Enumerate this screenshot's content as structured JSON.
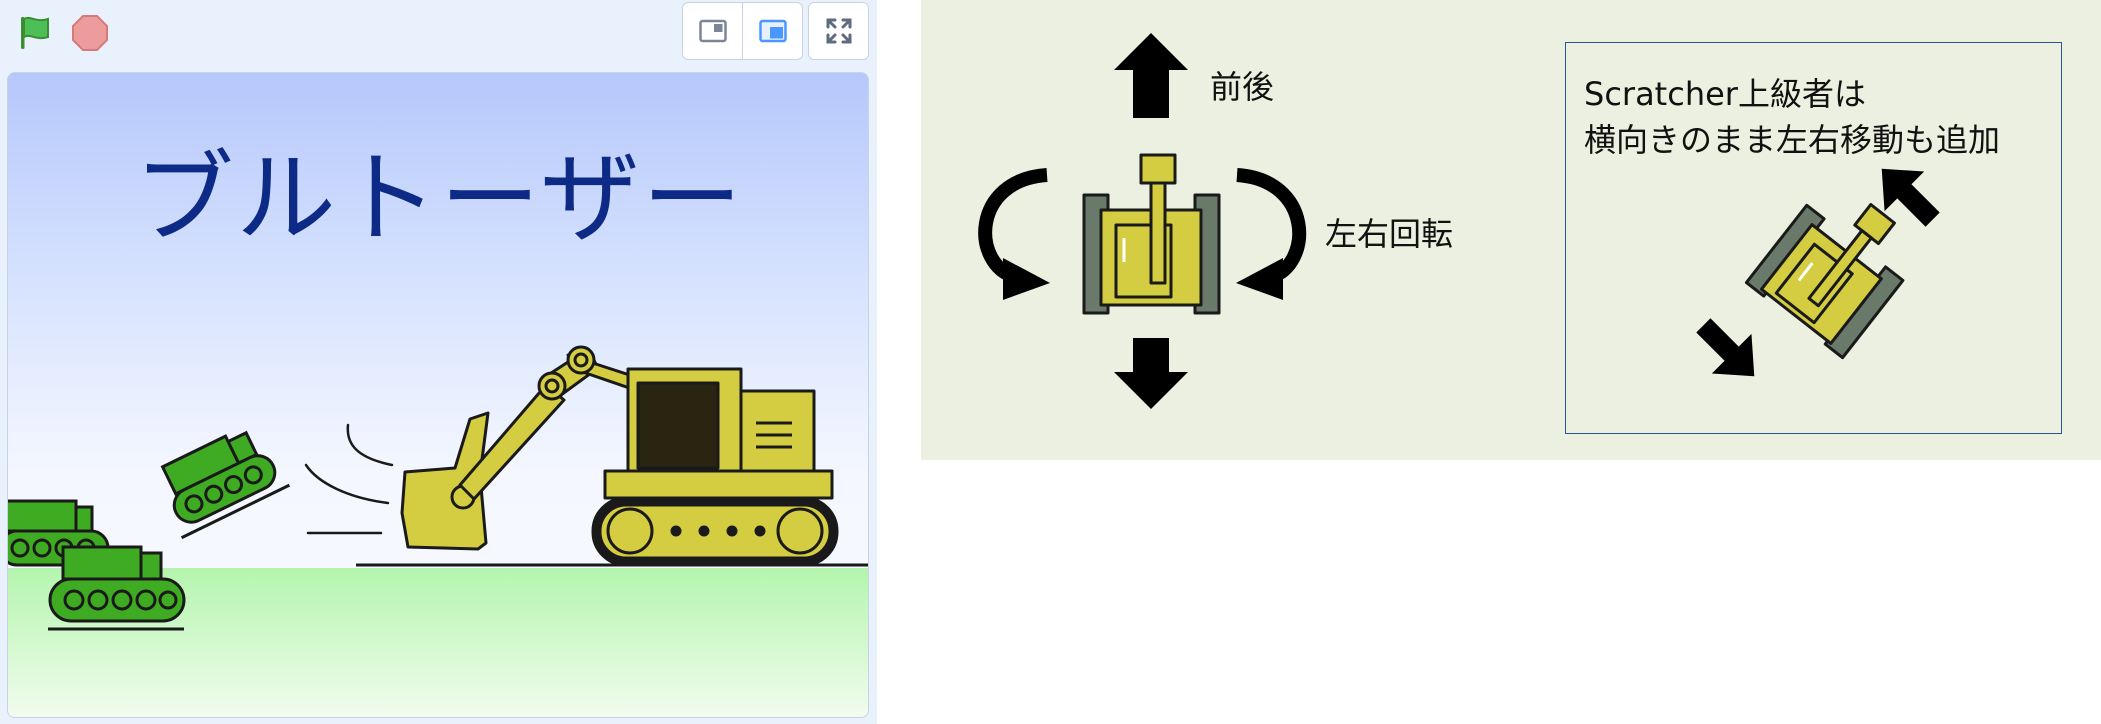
{
  "player": {
    "controls": {
      "green_flag_icon": "green-flag-icon",
      "stop_icon": "stop-sign-icon",
      "small_stage_icon": "small-stage-icon",
      "large_stage_icon": "large-stage-icon",
      "fullscreen_icon": "fullscreen-icon"
    },
    "stage": {
      "title": "ブルトーザー"
    }
  },
  "instructions": {
    "forward_back_label": "前後",
    "rotate_label": "左右回転",
    "advanced_note": {
      "line1": "Scratcher上級者は",
      "line2": "横向きのまま左右移動も追加"
    }
  },
  "colors": {
    "player_bg": "#e9f1fc",
    "stage_title": "#0d2a86",
    "panel_bg": "#ecf0e0",
    "box_border": "#2f5597",
    "excavator_yellow": "#d4cd42",
    "tank_green": "#3eab22"
  }
}
